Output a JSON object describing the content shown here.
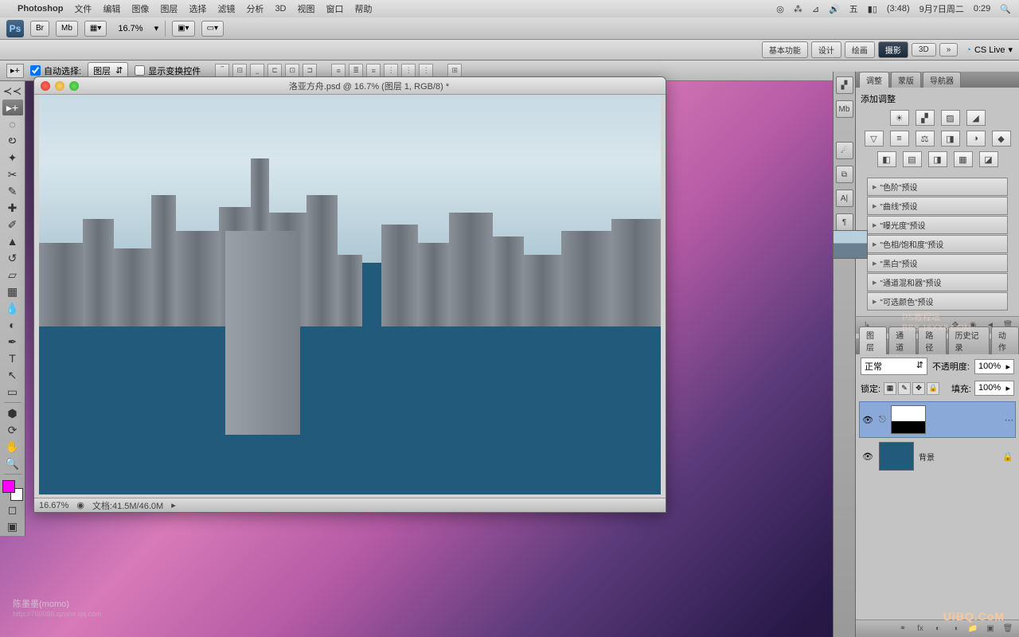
{
  "menubar": {
    "apple": "",
    "appname": "Photoshop",
    "items": [
      "文件",
      "编辑",
      "图像",
      "图层",
      "选择",
      "滤镜",
      "分析",
      "3D",
      "视图",
      "窗口",
      "帮助"
    ],
    "right": {
      "battery": "(3:48)",
      "date": "9月7日周二",
      "time": "0:29",
      "input": "五"
    }
  },
  "workspace": {
    "items": [
      "基本功能",
      "设计",
      "绘画",
      "摄影",
      "3D"
    ],
    "active": "摄影",
    "more": "»",
    "cslive": "CS Live"
  },
  "optionbar": {
    "zoom": "16.7%",
    "br": "Br",
    "mb": "Mb"
  },
  "movebar": {
    "autoselect": "自动选择:",
    "target": "图层",
    "showtransform": "显示变换控件"
  },
  "doc": {
    "title": "洛亚方舟.psd @ 16.7% (图层 1, RGB/8) *",
    "zoom": "16.67%",
    "filesize": "文档:41.5M/46.0M"
  },
  "panels": {
    "adjust": {
      "tabs": [
        "调整",
        "蒙版",
        "导航器"
      ],
      "title": "添加调整"
    },
    "presets": [
      "\"色阶\"预设",
      "\"曲线\"预设",
      "\"曝光度\"预设",
      "\"色相/饱和度\"预设",
      "\"黑白\"预设",
      "\"通道混和器\"预设",
      "\"可选颜色\"预设"
    ],
    "layertabs": [
      "图层",
      "通道",
      "路径",
      "历史记录",
      "动作"
    ],
    "blend": "正常",
    "opacity_label": "不透明度:",
    "opacity": "100%",
    "lock_label": "锁定:",
    "fill_label": "填充:",
    "fill": "100%",
    "layers": [
      {
        "name": "",
        "bg": false
      },
      {
        "name": "背景",
        "bg": true
      }
    ]
  },
  "watermark": {
    "name": "陈墨墨(momo)",
    "url": "http://760086.qzone.qq.com",
    "site": "UiBQ.CoM",
    "mid1": "PS教程坛",
    "mid2": "BBS.16XX8.COM"
  }
}
